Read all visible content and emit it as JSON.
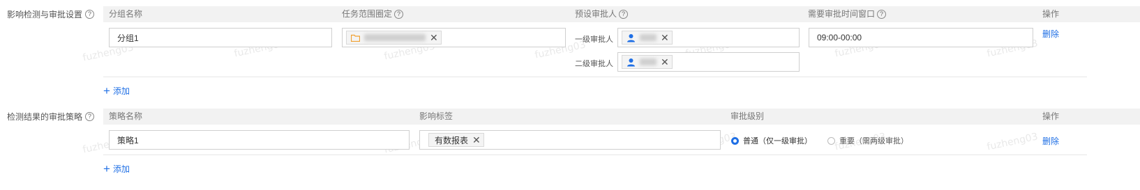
{
  "watermark_text": "fuzheng03",
  "approval_settings": {
    "section_label": "影响检测与审批设置",
    "headers": {
      "group_name": "分组名称",
      "task_scope": "任务范围圈定",
      "approver": "预设审批人",
      "time_window": "需要审批时间窗口",
      "action": "操作"
    },
    "row": {
      "group_name_value": "分组1",
      "level1_label": "一级审批人",
      "level2_label": "二级审批人",
      "time_window_value": "09:00-00:00",
      "delete_label": "删除"
    },
    "add_label": "添加"
  },
  "strategy_settings": {
    "section_label": "检测结果的审批策略",
    "headers": {
      "strategy_name": "策略名称",
      "impact_tag": "影响标签",
      "approval_level": "审批级别",
      "action": "操作"
    },
    "row": {
      "strategy_name_value": "策略1",
      "tag_value": "有数报表",
      "option_normal": "普通（仅一级审批）",
      "option_important": "重要（需两级审批）",
      "selected_option": "normal",
      "delete_label": "删除"
    },
    "add_label": "添加"
  },
  "colors": {
    "accent": "#1f6fe5",
    "folder": "#f0a030",
    "header_bg": "#f2f2f2"
  },
  "icons": {
    "help": "question-circle-icon",
    "folder": "folder-icon",
    "user": "user-icon",
    "close": "close-icon",
    "plus": "plus-icon"
  }
}
